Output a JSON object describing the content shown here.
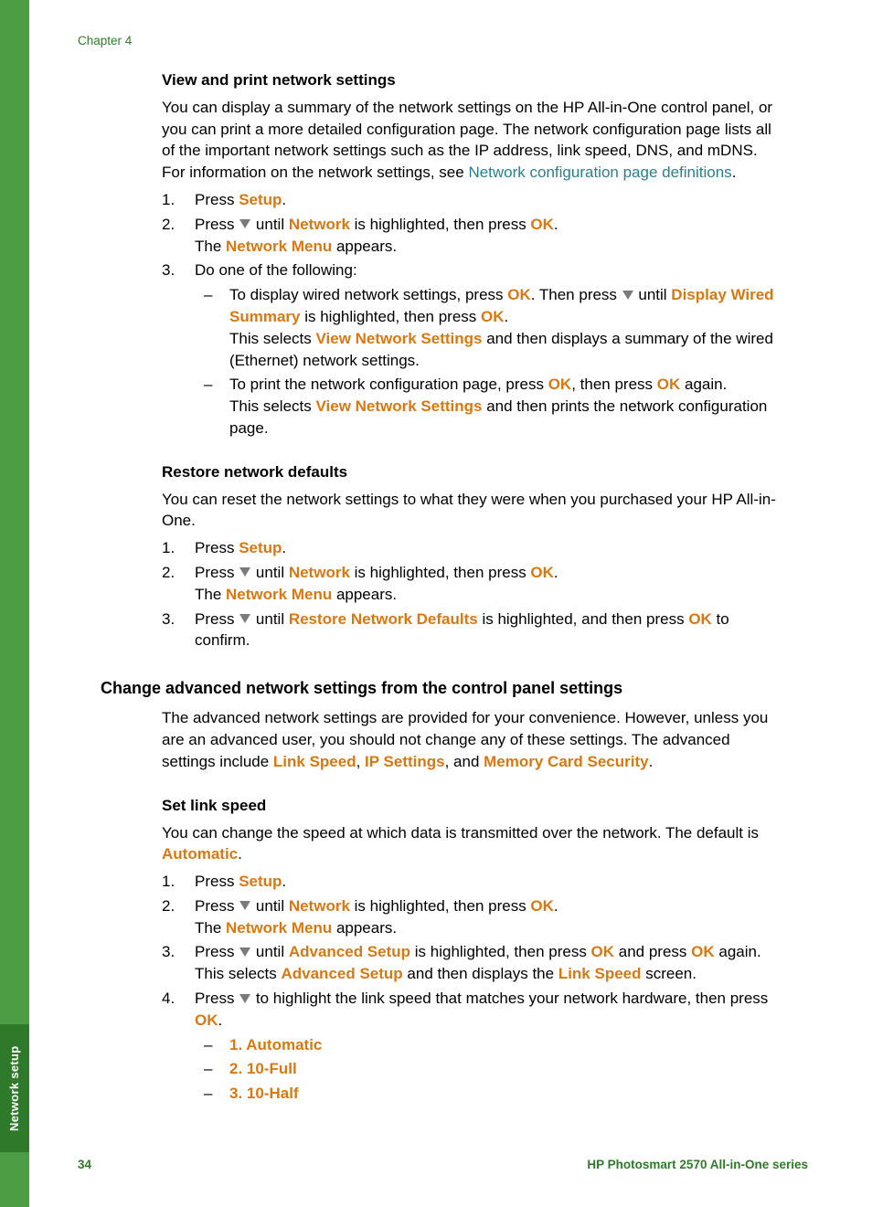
{
  "chapter": "Chapter 4",
  "sideTab": "Network setup",
  "footer": {
    "page": "34",
    "series": "HP Photosmart 2570 All-in-One series"
  },
  "s1": {
    "title": "View and print network settings",
    "intro1": "You can display a summary of the network settings on the HP All-in-One control panel, or you can print a more detailed configuration page. The network configuration page lists all of the important network settings such as the IP address, link speed, DNS, and mDNS. For information on the network settings, see ",
    "link": "Network configuration page definitions",
    "period": ".",
    "li1a": "Press ",
    "setup": "Setup",
    "li1b": ".",
    "li2a": "Press ",
    "li2b": " until ",
    "network": "Network",
    "li2c": " is highlighted, then press ",
    "ok": "OK",
    "li2d": ".",
    "li2e": "The ",
    "networkMenu": "Network Menu",
    "li2f": " appears.",
    "li3": "Do one of the following:",
    "b1a": "To display wired network settings, press ",
    "b1b": ". Then press ",
    "b1c": " until ",
    "dws": "Display Wired Summary",
    "b1d": " is highlighted, then press ",
    "b1e": ".",
    "b1f": "This selects ",
    "vns": "View Network Settings",
    "b1g": " and then displays a summary of the wired (Ethernet) network settings.",
    "b2a": "To print the network configuration page, press ",
    "b2b": ", then press ",
    "b2c": " again.",
    "b2d": "This selects ",
    "b2e": " and then prints the network configuration page."
  },
  "s2": {
    "title": "Restore network defaults",
    "intro": "You can reset the network settings to what they were when you purchased your HP All-in-One.",
    "li3a": "Press ",
    "li3b": " until ",
    "rnd": "Restore Network Defaults",
    "li3c": " is highlighted, and then press ",
    "li3d": " to confirm."
  },
  "s3": {
    "title": "Change advanced network settings from the control panel settings",
    "introA": "The advanced network settings are provided for your convenience. However, unless you are an advanced user, you should not change any of these settings. The advanced settings include ",
    "linkSpeed": "Link Speed",
    "comma": ", ",
    "ipSettings": "IP Settings",
    "and": ", and ",
    "mcs": "Memory Card Security",
    "period": "."
  },
  "s4": {
    "title": "Set link speed",
    "introA": "You can change the speed at which data is transmitted over the network. The default is ",
    "auto": "Automatic",
    "period": ".",
    "li3a": "Press ",
    "li3b": " until ",
    "advSetup": "Advanced Setup",
    "li3c": " is highlighted, then press ",
    "li3d": " and press ",
    "li3e": " again.",
    "li3f": "This selects ",
    "li3g": " and then displays the ",
    "li3h": " screen.",
    "li4a": "Press ",
    "li4b": " to highlight the link speed that matches your network hardware, then press ",
    "li4c": ".",
    "opt1": "1. Automatic",
    "opt2": "2. 10-Full",
    "opt3": "3. 10-Half"
  }
}
